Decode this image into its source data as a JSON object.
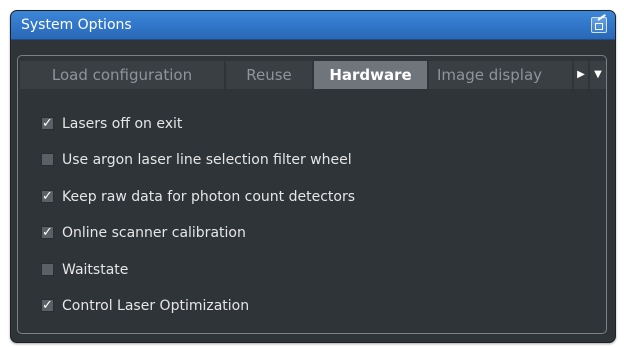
{
  "window": {
    "title": "System Options"
  },
  "tabs": [
    {
      "label": "Load configuration",
      "active": false
    },
    {
      "label": "Reuse",
      "active": false
    },
    {
      "label": "Hardware",
      "active": true
    },
    {
      "label": "Image display",
      "active": false
    }
  ],
  "options": [
    {
      "label": "Lasers off on exit",
      "checked": true
    },
    {
      "label": "Use argon laser line selection filter wheel",
      "checked": false
    },
    {
      "label": "Keep raw data for photon count detectors",
      "checked": true
    },
    {
      "label": "Online scanner calibration",
      "checked": true
    },
    {
      "label": "Waitstate",
      "checked": false
    },
    {
      "label": "Control Laser Optimization",
      "checked": true
    }
  ],
  "icons": {
    "title_button": "undock-icon",
    "tab_scroll": "chevron-right-icon",
    "tab_menu": "chevron-down-icon",
    "checkmark": "✓"
  },
  "colors": {
    "titlebar": "#2f74c6",
    "background": "#2f3439",
    "active_tab": "#6f757b",
    "text": "#e6e6e6"
  }
}
